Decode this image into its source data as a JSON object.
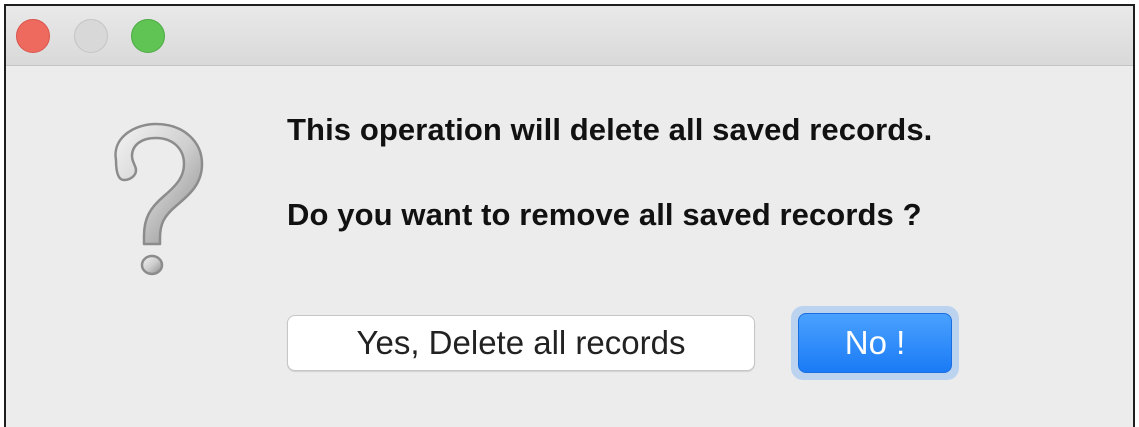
{
  "dialog": {
    "message_primary": "This operation will delete all saved records.",
    "message_secondary": "Do you want to remove all saved records ?",
    "icon": "question-mark-icon"
  },
  "buttons": {
    "confirm_label": "Yes, Delete all records",
    "cancel_label": "No !"
  },
  "colors": {
    "close": "#ee6a5f",
    "minimize": "#d8d8d8",
    "zoom": "#5fc454",
    "default_button": "#1a7bf5"
  }
}
